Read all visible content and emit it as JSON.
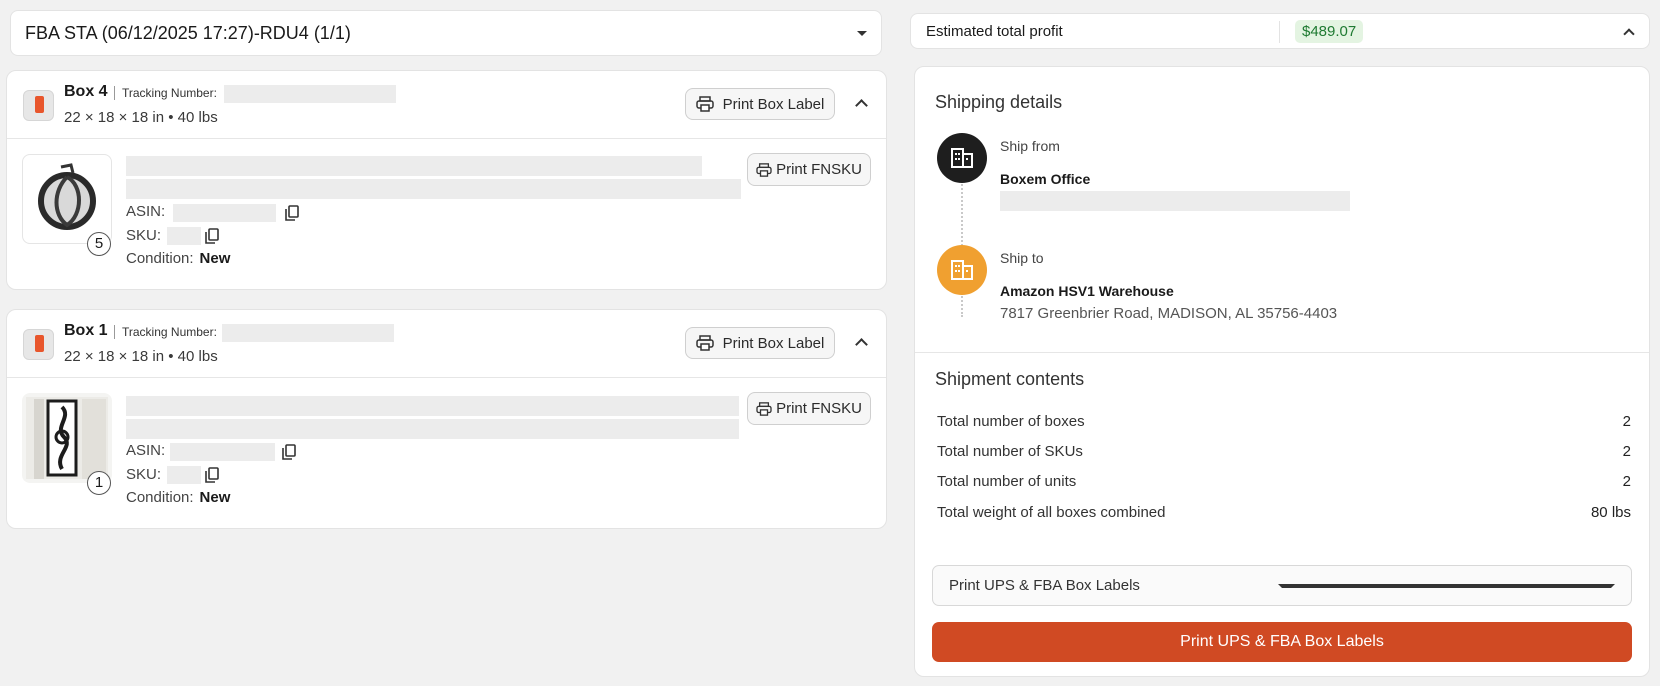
{
  "shipment": {
    "selected": "FBA STA (06/12/2025 17:27)-RDU4 (1/1)"
  },
  "boxes": [
    {
      "title": "Box 4",
      "tracking_label": "Tracking Number:",
      "dims": "22 × 18 × 18 in • 40 lbs",
      "print_label": "Print Box Label",
      "item": {
        "qty": "5",
        "asin_label": "ASIN:",
        "sku_label": "SKU:",
        "condition_label": "Condition:",
        "condition_value": "New",
        "print_fnsku": "Print FNSKU"
      }
    },
    {
      "title": "Box 1",
      "tracking_label": "Tracking Number:",
      "dims": "22 × 18 × 18 in • 40 lbs",
      "print_label": "Print Box Label",
      "item": {
        "qty": "1",
        "asin_label": "ASIN:",
        "sku_label": "SKU:",
        "condition_label": "Condition:",
        "condition_value": "New",
        "print_fnsku": "Print FNSKU"
      }
    }
  ],
  "profit": {
    "label": "Estimated total profit",
    "value": "$489.07"
  },
  "shipping": {
    "heading": "Shipping details",
    "from_label": "Ship from",
    "from_name": "Boxem Office",
    "to_label": "Ship to",
    "to_name": "Amazon HSV1 Warehouse",
    "to_address": "7817 Greenbrier Road, MADISON, AL 35756-4403"
  },
  "contents": {
    "heading": "Shipment contents",
    "rows": [
      {
        "label": "Total number of boxes",
        "value": "2"
      },
      {
        "label": "Total number of SKUs",
        "value": "2"
      },
      {
        "label": "Total number of units",
        "value": "2"
      },
      {
        "label": "Total weight of all boxes combined",
        "value": "80 lbs"
      }
    ]
  },
  "actions": {
    "label_select": "Print UPS & FBA Box Labels",
    "primary_button": "Print UPS & FBA Box Labels"
  },
  "colors": {
    "accent": "#d04a23",
    "profit_green": "#1f7a32",
    "ship_from": "#1e1e1e",
    "ship_to": "#f0a030"
  }
}
